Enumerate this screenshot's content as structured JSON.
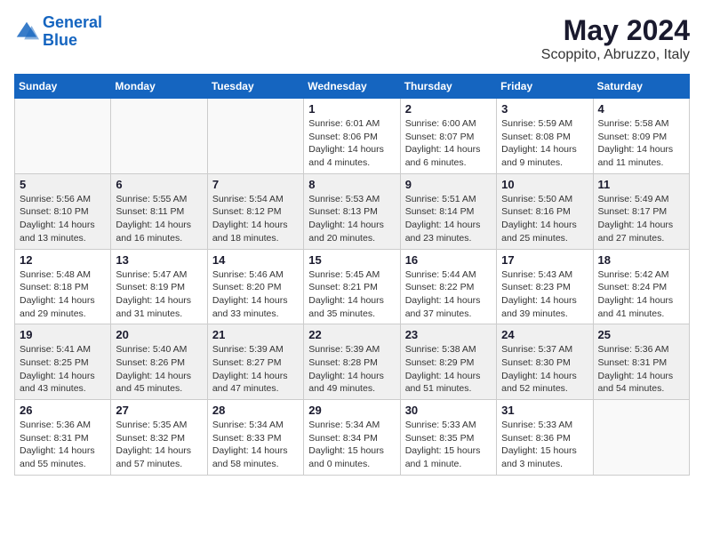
{
  "logo": {
    "line1": "General",
    "line2": "Blue"
  },
  "title": "May 2024",
  "subtitle": "Scoppito, Abruzzo, Italy",
  "days_of_week": [
    "Sunday",
    "Monday",
    "Tuesday",
    "Wednesday",
    "Thursday",
    "Friday",
    "Saturday"
  ],
  "weeks": [
    {
      "shaded": false,
      "days": [
        {
          "num": "",
          "info": ""
        },
        {
          "num": "",
          "info": ""
        },
        {
          "num": "",
          "info": ""
        },
        {
          "num": "1",
          "info": "Sunrise: 6:01 AM\nSunset: 8:06 PM\nDaylight: 14 hours\nand 4 minutes."
        },
        {
          "num": "2",
          "info": "Sunrise: 6:00 AM\nSunset: 8:07 PM\nDaylight: 14 hours\nand 6 minutes."
        },
        {
          "num": "3",
          "info": "Sunrise: 5:59 AM\nSunset: 8:08 PM\nDaylight: 14 hours\nand 9 minutes."
        },
        {
          "num": "4",
          "info": "Sunrise: 5:58 AM\nSunset: 8:09 PM\nDaylight: 14 hours\nand 11 minutes."
        }
      ]
    },
    {
      "shaded": true,
      "days": [
        {
          "num": "5",
          "info": "Sunrise: 5:56 AM\nSunset: 8:10 PM\nDaylight: 14 hours\nand 13 minutes."
        },
        {
          "num": "6",
          "info": "Sunrise: 5:55 AM\nSunset: 8:11 PM\nDaylight: 14 hours\nand 16 minutes."
        },
        {
          "num": "7",
          "info": "Sunrise: 5:54 AM\nSunset: 8:12 PM\nDaylight: 14 hours\nand 18 minutes."
        },
        {
          "num": "8",
          "info": "Sunrise: 5:53 AM\nSunset: 8:13 PM\nDaylight: 14 hours\nand 20 minutes."
        },
        {
          "num": "9",
          "info": "Sunrise: 5:51 AM\nSunset: 8:14 PM\nDaylight: 14 hours\nand 23 minutes."
        },
        {
          "num": "10",
          "info": "Sunrise: 5:50 AM\nSunset: 8:16 PM\nDaylight: 14 hours\nand 25 minutes."
        },
        {
          "num": "11",
          "info": "Sunrise: 5:49 AM\nSunset: 8:17 PM\nDaylight: 14 hours\nand 27 minutes."
        }
      ]
    },
    {
      "shaded": false,
      "days": [
        {
          "num": "12",
          "info": "Sunrise: 5:48 AM\nSunset: 8:18 PM\nDaylight: 14 hours\nand 29 minutes."
        },
        {
          "num": "13",
          "info": "Sunrise: 5:47 AM\nSunset: 8:19 PM\nDaylight: 14 hours\nand 31 minutes."
        },
        {
          "num": "14",
          "info": "Sunrise: 5:46 AM\nSunset: 8:20 PM\nDaylight: 14 hours\nand 33 minutes."
        },
        {
          "num": "15",
          "info": "Sunrise: 5:45 AM\nSunset: 8:21 PM\nDaylight: 14 hours\nand 35 minutes."
        },
        {
          "num": "16",
          "info": "Sunrise: 5:44 AM\nSunset: 8:22 PM\nDaylight: 14 hours\nand 37 minutes."
        },
        {
          "num": "17",
          "info": "Sunrise: 5:43 AM\nSunset: 8:23 PM\nDaylight: 14 hours\nand 39 minutes."
        },
        {
          "num": "18",
          "info": "Sunrise: 5:42 AM\nSunset: 8:24 PM\nDaylight: 14 hours\nand 41 minutes."
        }
      ]
    },
    {
      "shaded": true,
      "days": [
        {
          "num": "19",
          "info": "Sunrise: 5:41 AM\nSunset: 8:25 PM\nDaylight: 14 hours\nand 43 minutes."
        },
        {
          "num": "20",
          "info": "Sunrise: 5:40 AM\nSunset: 8:26 PM\nDaylight: 14 hours\nand 45 minutes."
        },
        {
          "num": "21",
          "info": "Sunrise: 5:39 AM\nSunset: 8:27 PM\nDaylight: 14 hours\nand 47 minutes."
        },
        {
          "num": "22",
          "info": "Sunrise: 5:39 AM\nSunset: 8:28 PM\nDaylight: 14 hours\nand 49 minutes."
        },
        {
          "num": "23",
          "info": "Sunrise: 5:38 AM\nSunset: 8:29 PM\nDaylight: 14 hours\nand 51 minutes."
        },
        {
          "num": "24",
          "info": "Sunrise: 5:37 AM\nSunset: 8:30 PM\nDaylight: 14 hours\nand 52 minutes."
        },
        {
          "num": "25",
          "info": "Sunrise: 5:36 AM\nSunset: 8:31 PM\nDaylight: 14 hours\nand 54 minutes."
        }
      ]
    },
    {
      "shaded": false,
      "days": [
        {
          "num": "26",
          "info": "Sunrise: 5:36 AM\nSunset: 8:31 PM\nDaylight: 14 hours\nand 55 minutes."
        },
        {
          "num": "27",
          "info": "Sunrise: 5:35 AM\nSunset: 8:32 PM\nDaylight: 14 hours\nand 57 minutes."
        },
        {
          "num": "28",
          "info": "Sunrise: 5:34 AM\nSunset: 8:33 PM\nDaylight: 14 hours\nand 58 minutes."
        },
        {
          "num": "29",
          "info": "Sunrise: 5:34 AM\nSunset: 8:34 PM\nDaylight: 15 hours\nand 0 minutes."
        },
        {
          "num": "30",
          "info": "Sunrise: 5:33 AM\nSunset: 8:35 PM\nDaylight: 15 hours\nand 1 minute."
        },
        {
          "num": "31",
          "info": "Sunrise: 5:33 AM\nSunset: 8:36 PM\nDaylight: 15 hours\nand 3 minutes."
        },
        {
          "num": "",
          "info": ""
        }
      ]
    }
  ]
}
